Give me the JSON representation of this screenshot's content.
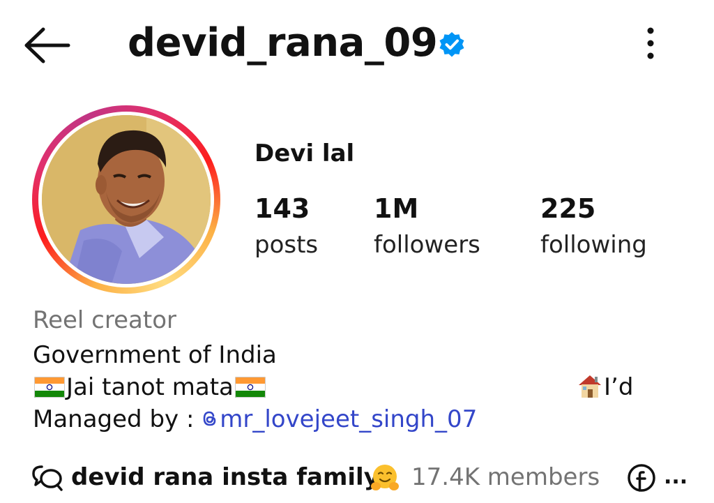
{
  "header": {
    "username": "devid_rana_09",
    "back_icon": "arrow-left-icon",
    "verified_icon": "verified-badge-icon",
    "more_icon": "more-vertical-icon"
  },
  "profile": {
    "display_name": "Devi lal",
    "stats": [
      {
        "value": "143",
        "label": "posts"
      },
      {
        "value": "1M",
        "label": "followers"
      },
      {
        "value": "225",
        "label": "following"
      }
    ]
  },
  "bio": {
    "category": "Reel creator",
    "line1": "Government of India",
    "line2": "Jai tanot mata",
    "line2_right": "I’d",
    "managed_prefix": "Managed by : ",
    "managed_handle": "mr_lovejeet_singh_07"
  },
  "community": {
    "name": "devid rana insta family",
    "members": "17.4K members",
    "more": "..."
  },
  "colors": {
    "link": "#3346c9",
    "muted": "#737373",
    "verified": "#0095f6"
  }
}
